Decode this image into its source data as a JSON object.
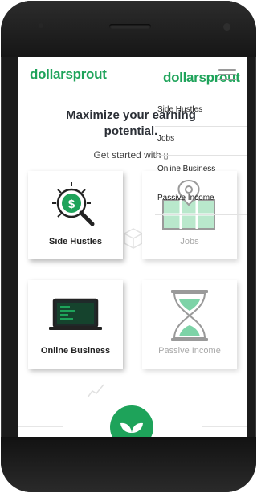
{
  "header": {
    "logo_text": "dollarsprout",
    "logo_overlay_text": "dollarsprout"
  },
  "hero": {
    "title": "Maximize your earning potential.",
    "subtitle": "Get started with",
    "subtitle_icon": "hand-pointing-down-icon"
  },
  "menu": {
    "items": [
      {
        "label": "Side Hustles"
      },
      {
        "label": "Jobs"
      },
      {
        "label": "Online Business"
      },
      {
        "label": "Passive Income"
      }
    ]
  },
  "cards": [
    {
      "label": "Side Hustles",
      "icon": "money-magnifier-icon"
    },
    {
      "label": "Jobs",
      "icon": "map-pin-icon"
    },
    {
      "label": "Online Business",
      "icon": "laptop-icon"
    },
    {
      "label": "Passive Income",
      "icon": "hourglass-icon"
    }
  ],
  "colors": {
    "brand_green": "#1ea35a",
    "light_green": "#7dd3a7",
    "text_dark": "#222222",
    "muted": "#a9a9a9"
  },
  "bottom": {
    "badge_icon": "sprout-leaves-icon"
  }
}
